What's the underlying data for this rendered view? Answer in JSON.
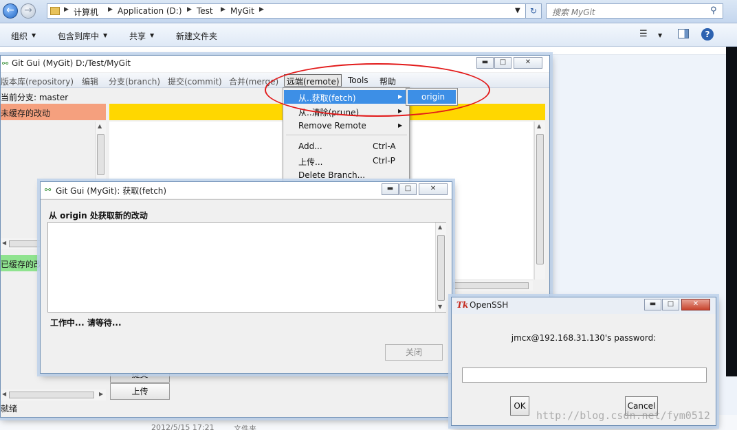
{
  "explorer": {
    "path": [
      "计算机",
      "Application (D:)",
      "Test",
      "MyGit"
    ],
    "search_placeholder": "搜索 MyGit",
    "toolbar": [
      "组织",
      "包含到库中",
      "共享",
      "新建文件夹"
    ],
    "file_date": "2012/5/15 17:21",
    "file_type": "文件夹"
  },
  "git_main": {
    "title": "Git Gui (MyGit) D:/Test/MyGit",
    "menu": [
      "版本库(repository)",
      "编辑",
      "分支(branch)",
      "提交(commit)",
      "合并(merge)",
      "远端(remote)",
      "Tools",
      "帮助"
    ],
    "current_branch": "当前分支: master",
    "unstaged_header": "未缓存的改动",
    "staged_header": "已缓存的改",
    "commit_button": "提交",
    "push_button": "上传",
    "status": "就绪"
  },
  "remote_menu": {
    "items": [
      {
        "label": "从..获取(fetch)",
        "shortcut": "",
        "submenu": true
      },
      {
        "label": "从..清除(prune)",
        "shortcut": "",
        "submenu": true
      },
      {
        "label": "Remove Remote",
        "shortcut": "",
        "submenu": true
      },
      {
        "label": "Add...",
        "shortcut": "Ctrl-A",
        "submenu": false
      },
      {
        "label": "上传...",
        "shortcut": "Ctrl-P",
        "submenu": false
      },
      {
        "label": "Delete Branch...",
        "shortcut": "",
        "submenu": false
      }
    ],
    "submenu_item": "origin"
  },
  "fetch_window": {
    "title": "Git Gui (MyGit): 获取(fetch)",
    "heading": "从 origin 处获取新的改动",
    "status": "工作中... 请等待...",
    "close_button": "关闭"
  },
  "ssh_window": {
    "title": "OpenSSH",
    "prompt": "jmcx@192.168.31.130's password:",
    "password_value": "",
    "ok_button": "OK",
    "cancel_button": "Cancel"
  },
  "watermark": "http://blog.csdn.net/fym0512",
  "colors": {
    "unstaged": "#f5a07e",
    "diff_header": "#ffd700",
    "staged": "#8fe38f",
    "highlight": "#3d8fe6",
    "annotation": "#e21a1a"
  }
}
